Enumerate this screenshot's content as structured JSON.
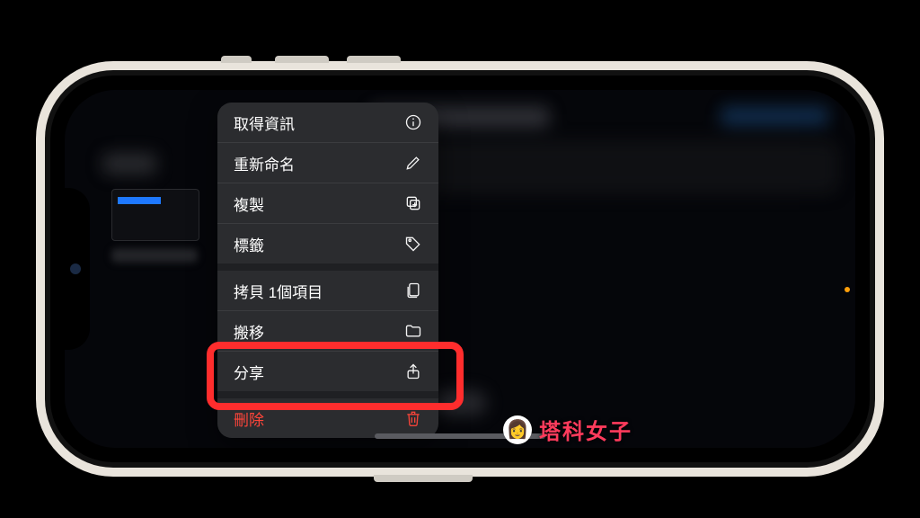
{
  "menu": {
    "get_info": "取得資訊",
    "rename": "重新命名",
    "duplicate": "複製",
    "tags": "標籤",
    "copy_item": "拷貝 1個項目",
    "move": "搬移",
    "share": "分享",
    "delete": "刪除"
  },
  "watermark": {
    "text": "塔科女子"
  },
  "colors": {
    "highlight": "#ff2d2d",
    "destructive": "#ff453a",
    "menu_bg": "#2b2c2f"
  }
}
